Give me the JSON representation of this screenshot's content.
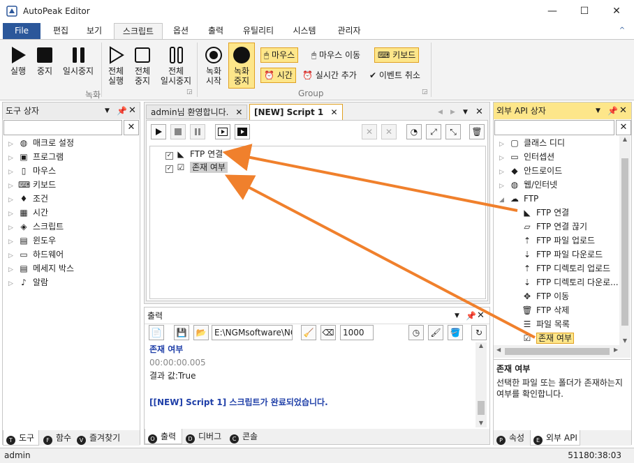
{
  "window": {
    "title": "AutoPeak Editor",
    "minimize": "—",
    "maximize": "☐",
    "close": "✕"
  },
  "menu": {
    "tabs": [
      "File",
      "편집",
      "보기",
      "스크립트",
      "옵션",
      "출력",
      "유틸리티",
      "시스템",
      "관리자"
    ],
    "active": "스크립트",
    "collapse": "^"
  },
  "ribbon": {
    "record_group": {
      "label": "녹화",
      "buttons": [
        {
          "label1": "실행",
          "label2": ""
        },
        {
          "label1": "중지",
          "label2": ""
        },
        {
          "label1": "일시중지",
          "label2": ""
        },
        {
          "label1": "전체",
          "label2": "실행"
        },
        {
          "label1": "전체",
          "label2": "중지"
        },
        {
          "label1": "전체",
          "label2": "일시중지"
        }
      ]
    },
    "group_group": {
      "label": "Group",
      "record_start": {
        "label1": "녹화",
        "label2": "시작"
      },
      "record_stop": {
        "label1": "녹화",
        "label2": "중지"
      },
      "mouse": "마우스",
      "mouse_move": "마우스 이동",
      "keyboard": "키보드",
      "time": "시간",
      "realtime_add": "실시간 추가",
      "event_cancel": "이벤트 취소"
    }
  },
  "toolbox": {
    "title": "도구 상자",
    "items": [
      "매크로 설정",
      "프로그램",
      "마우스",
      "키보드",
      "조건",
      "시간",
      "스크립트",
      "윈도우",
      "하드웨어",
      "메세지 박스",
      "알람"
    ],
    "tabs": [
      {
        "icon": "T",
        "label": "도구"
      },
      {
        "icon": "F",
        "label": "함수"
      },
      {
        "icon": "V",
        "label": "즐겨찾기"
      }
    ]
  },
  "editor": {
    "tabs": [
      "admin님 환영합니다.",
      "[NEW] Script 1"
    ],
    "script_items": [
      {
        "label": "FTP 연결"
      },
      {
        "label": "존재 여부"
      }
    ]
  },
  "output": {
    "title": "출력",
    "path": "E:\\NGMsoftware\\NG",
    "count": "1000",
    "lines": [
      {
        "text": "존재 여부",
        "color": "#1f3fa8",
        "bold": true
      },
      {
        "text": "00:00:00.005",
        "color": "#888888",
        "bold": false
      },
      {
        "text": "결과 값:True",
        "color": "#1e1e1e",
        "bold": false
      },
      {
        "text": "",
        "color": "#1e1e1e",
        "bold": false
      },
      {
        "text": "[[NEW] Script 1] 스크립트가 완료되었습니다.",
        "color": "#1f3fa8",
        "bold": true
      }
    ],
    "tabs": [
      {
        "icon": "O",
        "label": "출력"
      },
      {
        "icon": "D",
        "label": "디버그"
      },
      {
        "icon": "C",
        "label": "콘솔"
      }
    ]
  },
  "api": {
    "title": "외부 API 상자",
    "groups": [
      "클래스 디디",
      "인터셉션",
      "안드로이드",
      "웹/인터넷"
    ],
    "ftp": {
      "label": "FTP",
      "items": [
        "FTP 연결",
        "FTP 연결 끊기",
        "FTP 파일 업로드",
        "FTP 파일 다운로드",
        "FTP 디렉토리 업로드",
        "FTP 디렉토리 다운로...",
        "FTP 이동",
        "FTP 삭제",
        "파일 목록",
        "존재 여부"
      ]
    },
    "desc_title": "존재 여부",
    "desc_text": "선택한 파일 또는 폴더가 존재하는지 여부를 확인합니다.",
    "tabs": [
      {
        "icon": "P",
        "label": "속성"
      },
      {
        "icon": "E",
        "label": "외부 API"
      }
    ]
  },
  "status": {
    "user": "admin",
    "time": "51180:38:03"
  },
  "colors": {
    "accent": "#2b579a",
    "highlight": "#fde68a",
    "arrow": "#f0802c"
  }
}
